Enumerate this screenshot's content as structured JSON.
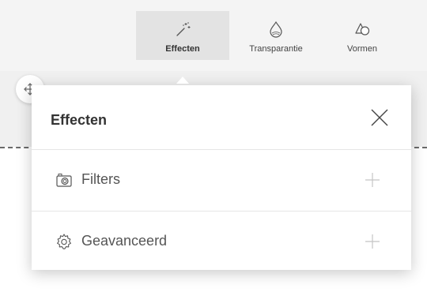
{
  "toolbar": {
    "items": [
      {
        "label": "Effecten",
        "icon": "magic-wand-icon",
        "active": true
      },
      {
        "label": "Transparantie",
        "icon": "transparency-drop-icon",
        "active": false
      },
      {
        "label": "Vormen",
        "icon": "shapes-icon",
        "active": false
      }
    ]
  },
  "panel": {
    "title": "Effecten",
    "close_icon": "close-icon",
    "rows": [
      {
        "label": "Filters",
        "icon": "camera-icon",
        "action_icon": "plus-icon"
      },
      {
        "label": "Geavanceerd",
        "icon": "gear-icon",
        "action_icon": "plus-icon"
      }
    ]
  },
  "move_handle": {
    "icon": "move-arrows-icon"
  },
  "colors": {
    "active_tab_bg": "#e3e3e3",
    "panel_bg": "#ffffff",
    "icon_color": "#555555",
    "plus_color": "#c4c4c4"
  }
}
